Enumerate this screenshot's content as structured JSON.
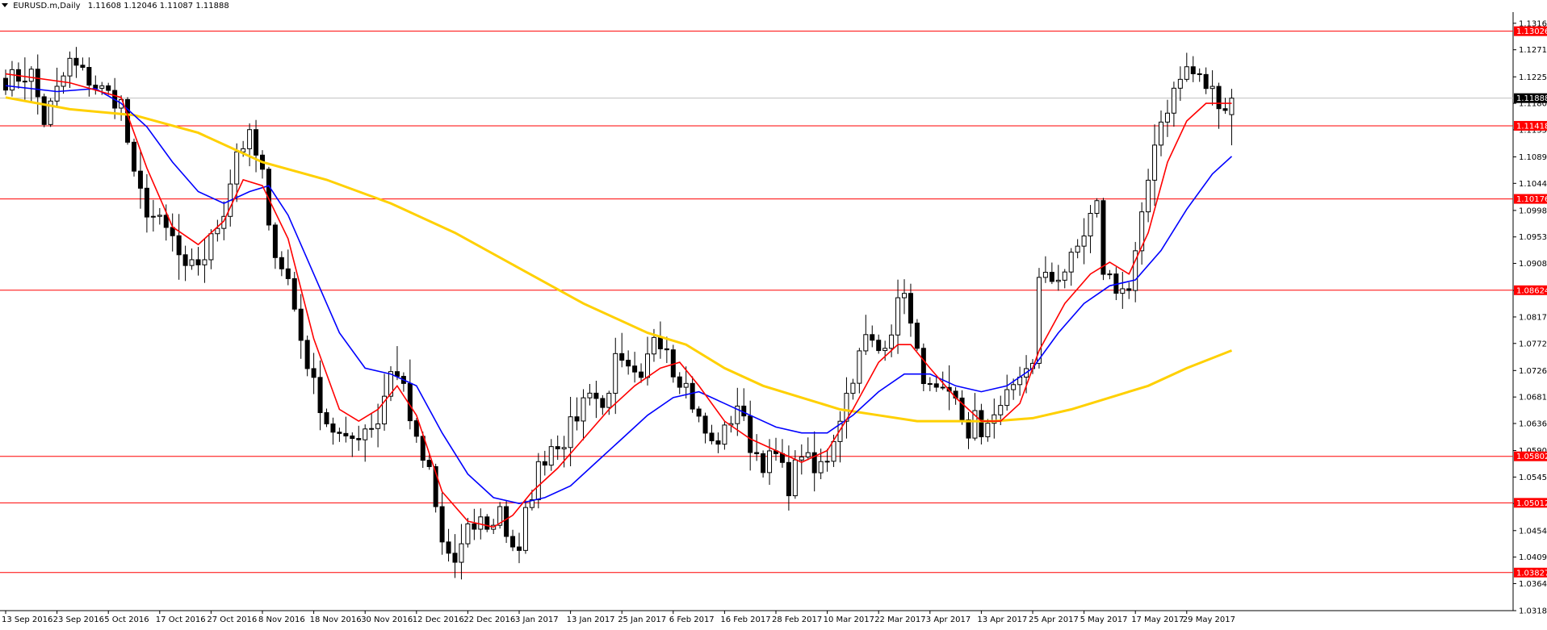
{
  "header": {
    "symbol": "EURUSD.m,Daily",
    "ohlc": "1.11608 1.12046 1.11087 1.11888"
  },
  "colors": {
    "background": "#ffffff",
    "candle": "#000000",
    "level_line": "#ff0000",
    "ma_fast": "#ff0000",
    "ma_mid": "#0000ff",
    "ma_slow": "#ffd000",
    "price_line": "#c0c0c0",
    "price_tag_bg": "#000000"
  },
  "chart_data": {
    "type": "candlestick",
    "ylim": [
      1.0318,
      1.1335
    ],
    "xlim": [
      0,
      185
    ],
    "y_ticks": [
      "1.13160",
      "1.12710",
      "1.12250",
      "1.11800",
      "1.11350",
      "1.10890",
      "1.10440",
      "1.09980",
      "1.09530",
      "1.09080",
      "1.08620",
      "1.08170",
      "1.07720",
      "1.07260",
      "1.06810",
      "1.06360",
      "1.05900",
      "1.05450",
      "1.05000",
      "1.04540",
      "1.04090",
      "1.03640",
      "1.03180"
    ],
    "x_ticks": [
      {
        "i": 0,
        "label": "13 Sep 2016"
      },
      {
        "i": 8,
        "label": "23 Sep 2016"
      },
      {
        "i": 16,
        "label": "5 Oct 2016"
      },
      {
        "i": 24,
        "label": "17 Oct 2016"
      },
      {
        "i": 32,
        "label": "27 Oct 2016"
      },
      {
        "i": 40,
        "label": "8 Nov 2016"
      },
      {
        "i": 48,
        "label": "18 Nov 2016"
      },
      {
        "i": 56,
        "label": "30 Nov 2016"
      },
      {
        "i": 64,
        "label": "12 Dec 2016"
      },
      {
        "i": 72,
        "label": "22 Dec 2016"
      },
      {
        "i": 80,
        "label": "3 Jan 2017"
      },
      {
        "i": 88,
        "label": "13 Jan 2017"
      },
      {
        "i": 96,
        "label": "25 Jan 2017"
      },
      {
        "i": 104,
        "label": "6 Feb 2017"
      },
      {
        "i": 112,
        "label": "16 Feb 2017"
      },
      {
        "i": 120,
        "label": "28 Feb 2017"
      },
      {
        "i": 128,
        "label": "10 Mar 2017"
      },
      {
        "i": 136,
        "label": "22 Mar 2017"
      },
      {
        "i": 144,
        "label": "3 Apr 2017"
      },
      {
        "i": 152,
        "label": "13 Apr 2017"
      },
      {
        "i": 160,
        "label": "25 Apr 2017"
      },
      {
        "i": 168,
        "label": "5 May 2017"
      },
      {
        "i": 176,
        "label": "17 May 2017"
      },
      {
        "i": 184,
        "label": "29 May 2017"
      }
    ],
    "levels": [
      {
        "value": 1.13026,
        "label": "1.13026"
      },
      {
        "value": 1.11418,
        "label": "1.11418"
      },
      {
        "value": 1.10176,
        "label": "1.10176"
      },
      {
        "value": 1.08624,
        "label": "1.08624"
      },
      {
        "value": 1.05802,
        "label": "1.05802"
      },
      {
        "value": 1.05012,
        "label": "1.05012"
      },
      {
        "value": 1.03827,
        "label": "1.03827"
      }
    ],
    "current_price": {
      "value": 1.11888,
      "label": "1.11888"
    },
    "close_anchors": [
      [
        0,
        1.122
      ],
      [
        4,
        1.123
      ],
      [
        6,
        1.115
      ],
      [
        10,
        1.125
      ],
      [
        14,
        1.121
      ],
      [
        18,
        1.118
      ],
      [
        20,
        1.105
      ],
      [
        22,
        1.1
      ],
      [
        26,
        1.095
      ],
      [
        28,
        1.089
      ],
      [
        31,
        1.092
      ],
      [
        34,
        1.1
      ],
      [
        36,
        1.11
      ],
      [
        38,
        1.112
      ],
      [
        40,
        1.106
      ],
      [
        41,
        1.096
      ],
      [
        44,
        1.088
      ],
      [
        46,
        1.078
      ],
      [
        48,
        1.07
      ],
      [
        50,
        1.064
      ],
      [
        53,
        1.06
      ],
      [
        56,
        1.063
      ],
      [
        58,
        1.064
      ],
      [
        60,
        1.073
      ],
      [
        62,
        1.07
      ],
      [
        64,
        1.06
      ],
      [
        66,
        1.055
      ],
      [
        68,
        1.043
      ],
      [
        70,
        1.04
      ],
      [
        72,
        1.045
      ],
      [
        74,
        1.047
      ],
      [
        76,
        1.046
      ],
      [
        77,
        1.05
      ],
      [
        78,
        1.045
      ],
      [
        80,
        1.041
      ],
      [
        81,
        1.048
      ],
      [
        83,
        1.056
      ],
      [
        85,
        1.06
      ],
      [
        87,
        1.061
      ],
      [
        89,
        1.065
      ],
      [
        91,
        1.07
      ],
      [
        93,
        1.066
      ],
      [
        95,
        1.074
      ],
      [
        97,
        1.072
      ],
      [
        99,
        1.07
      ],
      [
        101,
        1.079
      ],
      [
        103,
        1.077
      ],
      [
        104,
        1.073
      ],
      [
        106,
        1.07
      ],
      [
        108,
        1.064
      ],
      [
        110,
        1.06
      ],
      [
        112,
        1.062
      ],
      [
        114,
        1.067
      ],
      [
        116,
        1.06
      ],
      [
        118,
        1.057
      ],
      [
        120,
        1.058
      ],
      [
        122,
        1.053
      ],
      [
        124,
        1.059
      ],
      [
        126,
        1.055
      ],
      [
        128,
        1.058
      ],
      [
        130,
        1.065
      ],
      [
        132,
        1.072
      ],
      [
        134,
        1.078
      ],
      [
        136,
        1.076
      ],
      [
        138,
        1.08
      ],
      [
        140,
        1.087
      ],
      [
        141,
        1.08
      ],
      [
        142,
        1.075
      ],
      [
        144,
        1.069
      ],
      [
        146,
        1.068
      ],
      [
        148,
        1.067
      ],
      [
        150,
        1.062
      ],
      [
        151,
        1.065
      ],
      [
        152,
        1.06
      ],
      [
        153,
        1.064
      ],
      [
        154,
        1.066
      ],
      [
        156,
        1.068
      ],
      [
        158,
        1.072
      ],
      [
        160,
        1.073
      ],
      [
        161,
        1.089
      ],
      [
        163,
        1.088
      ],
      [
        165,
        1.09
      ],
      [
        167,
        1.092
      ],
      [
        169,
        1.098
      ],
      [
        170,
        1.1
      ],
      [
        171,
        1.09
      ],
      [
        173,
        1.087
      ],
      [
        175,
        1.086
      ],
      [
        177,
        1.098
      ],
      [
        179,
        1.112
      ],
      [
        180,
        1.115
      ],
      [
        182,
        1.12
      ],
      [
        184,
        1.124
      ],
      [
        186,
        1.122
      ],
      [
        188,
        1.12
      ],
      [
        190,
        1.1175
      ],
      [
        191,
        1.1189
      ]
    ],
    "ma_fast_pts": [
      [
        0,
        1.123
      ],
      [
        10,
        1.1215
      ],
      [
        18,
        1.119
      ],
      [
        22,
        1.107
      ],
      [
        26,
        1.097
      ],
      [
        30,
        1.094
      ],
      [
        34,
        1.098
      ],
      [
        37,
        1.105
      ],
      [
        40,
        1.104
      ],
      [
        44,
        1.095
      ],
      [
        48,
        1.078
      ],
      [
        52,
        1.066
      ],
      [
        55,
        1.064
      ],
      [
        58,
        1.066
      ],
      [
        61,
        1.07
      ],
      [
        64,
        1.065
      ],
      [
        68,
        1.052
      ],
      [
        72,
        1.047
      ],
      [
        76,
        1.046
      ],
      [
        79,
        1.048
      ],
      [
        82,
        1.052
      ],
      [
        86,
        1.056
      ],
      [
        90,
        1.061
      ],
      [
        94,
        1.066
      ],
      [
        98,
        1.07
      ],
      [
        102,
        1.073
      ],
      [
        105,
        1.074
      ],
      [
        108,
        1.07
      ],
      [
        112,
        1.064
      ],
      [
        116,
        1.061
      ],
      [
        120,
        1.059
      ],
      [
        124,
        1.057
      ],
      [
        128,
        1.059
      ],
      [
        132,
        1.066
      ],
      [
        136,
        1.074
      ],
      [
        139,
        1.077
      ],
      [
        141,
        1.077
      ],
      [
        144,
        1.073
      ],
      [
        148,
        1.068
      ],
      [
        152,
        1.064
      ],
      [
        155,
        1.064
      ],
      [
        158,
        1.067
      ],
      [
        161,
        1.076
      ],
      [
        165,
        1.084
      ],
      [
        169,
        1.089
      ],
      [
        172,
        1.091
      ],
      [
        175,
        1.089
      ],
      [
        178,
        1.096
      ],
      [
        181,
        1.108
      ],
      [
        184,
        1.115
      ],
      [
        187,
        1.118
      ],
      [
        190,
        1.118
      ],
      [
        191,
        1.118
      ]
    ],
    "ma_mid_pts": [
      [
        0,
        1.121
      ],
      [
        8,
        1.12
      ],
      [
        14,
        1.1205
      ],
      [
        18,
        1.118
      ],
      [
        22,
        1.114
      ],
      [
        26,
        1.108
      ],
      [
        30,
        1.103
      ],
      [
        34,
        1.101
      ],
      [
        38,
        1.103
      ],
      [
        41,
        1.104
      ],
      [
        44,
        1.099
      ],
      [
        48,
        1.089
      ],
      [
        52,
        1.079
      ],
      [
        56,
        1.073
      ],
      [
        60,
        1.072
      ],
      [
        64,
        1.07
      ],
      [
        68,
        1.062
      ],
      [
        72,
        1.055
      ],
      [
        76,
        1.051
      ],
      [
        80,
        1.05
      ],
      [
        84,
        1.051
      ],
      [
        88,
        1.053
      ],
      [
        92,
        1.057
      ],
      [
        96,
        1.061
      ],
      [
        100,
        1.065
      ],
      [
        104,
        1.068
      ],
      [
        108,
        1.069
      ],
      [
        112,
        1.067
      ],
      [
        116,
        1.065
      ],
      [
        120,
        1.063
      ],
      [
        124,
        1.062
      ],
      [
        128,
        1.062
      ],
      [
        132,
        1.065
      ],
      [
        136,
        1.069
      ],
      [
        140,
        1.072
      ],
      [
        144,
        1.072
      ],
      [
        148,
        1.07
      ],
      [
        152,
        1.069
      ],
      [
        156,
        1.07
      ],
      [
        160,
        1.073
      ],
      [
        164,
        1.079
      ],
      [
        168,
        1.084
      ],
      [
        172,
        1.087
      ],
      [
        176,
        1.088
      ],
      [
        180,
        1.093
      ],
      [
        184,
        1.1
      ],
      [
        188,
        1.106
      ],
      [
        191,
        1.109
      ]
    ],
    "ma_slow_pts": [
      [
        0,
        1.119
      ],
      [
        10,
        1.117
      ],
      [
        20,
        1.116
      ],
      [
        30,
        1.113
      ],
      [
        40,
        1.108
      ],
      [
        50,
        1.105
      ],
      [
        60,
        1.101
      ],
      [
        70,
        1.096
      ],
      [
        80,
        1.09
      ],
      [
        90,
        1.084
      ],
      [
        100,
        1.079
      ],
      [
        106,
        1.077
      ],
      [
        112,
        1.073
      ],
      [
        118,
        1.07
      ],
      [
        124,
        1.068
      ],
      [
        130,
        1.066
      ],
      [
        136,
        1.065
      ],
      [
        142,
        1.064
      ],
      [
        148,
        1.064
      ],
      [
        154,
        1.064
      ],
      [
        160,
        1.0645
      ],
      [
        166,
        1.066
      ],
      [
        172,
        1.068
      ],
      [
        178,
        1.07
      ],
      [
        184,
        1.073
      ],
      [
        191,
        1.076
      ]
    ],
    "last_candle": {
      "open": 1.11608,
      "high": 1.12046,
      "low": 1.11087,
      "close": 1.11888
    }
  }
}
